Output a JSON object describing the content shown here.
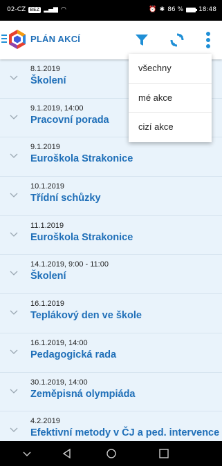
{
  "status_bar": {
    "carrier": "02-CZ",
    "carrier_badge": "BEZ",
    "battery_percent": "86 %",
    "time": "18:48"
  },
  "app_bar": {
    "title": "PLÁN AKCÍ",
    "icons": [
      "menu-icon",
      "app-logo",
      "filter-icon",
      "refresh-icon",
      "more-vert-icon"
    ]
  },
  "filter_menu": {
    "items": [
      "všechny",
      "mé akce",
      "cizí akce"
    ]
  },
  "events": [
    {
      "date": "8.1.2019",
      "title": "Školení"
    },
    {
      "date": "9.1.2019, 14:00",
      "title": "Pracovní porada"
    },
    {
      "date": "9.1.2019",
      "title": "Euroškola Strakonice"
    },
    {
      "date": "10.1.2019",
      "title": "Třídní schůzky"
    },
    {
      "date": "11.1.2019",
      "title": "Euroškola Strakonice"
    },
    {
      "date": "14.1.2019, 9:00 - 11:00",
      "title": "Školení"
    },
    {
      "date": "16.1.2019",
      "title": "Teplákový den ve škole"
    },
    {
      "date": "16.1.2019, 14:00",
      "title": "Pedagogická rada"
    },
    {
      "date": "30.1.2019, 14:00",
      "title": "Zeměpisná olympiáda"
    },
    {
      "date": "4.2.2019",
      "title": "Efektivní metody v ČJ a ped. intervence"
    }
  ],
  "colors": {
    "accent": "#1f6fb8",
    "list_background": "#e9f3fb",
    "icon_blue": "#1f8fd6"
  }
}
